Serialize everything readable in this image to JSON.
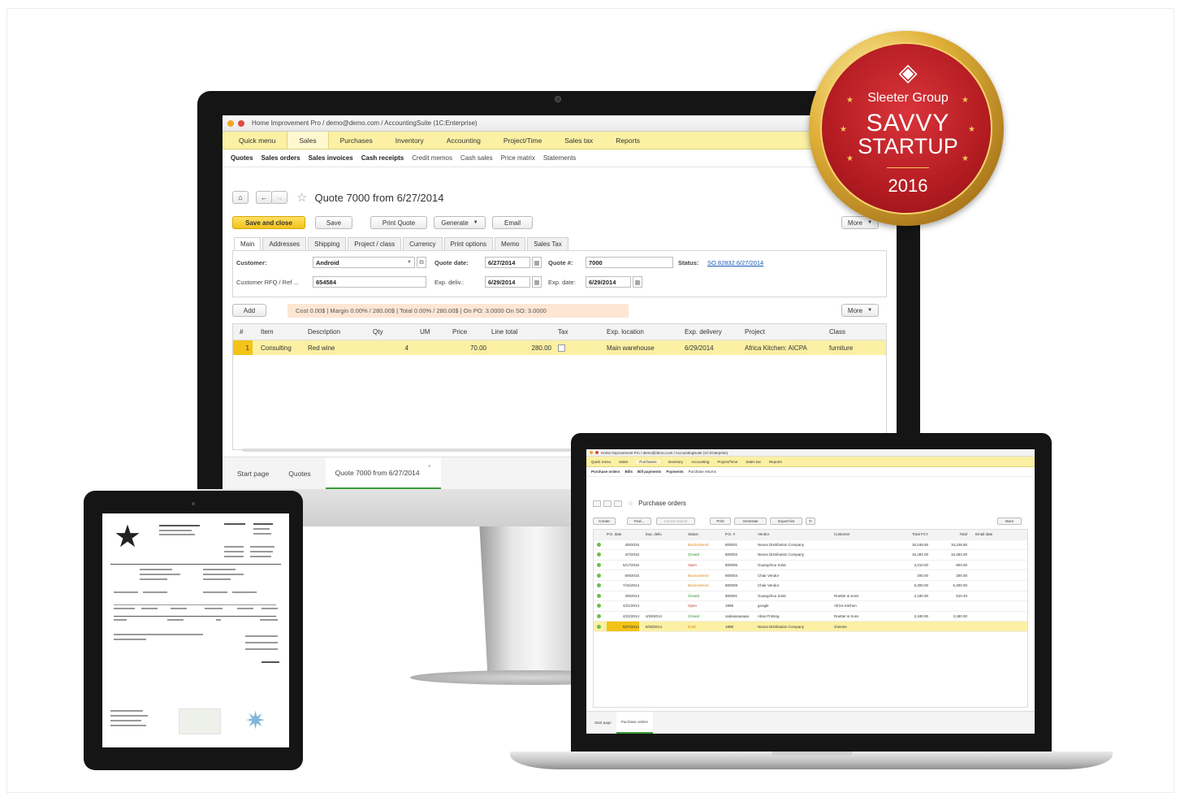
{
  "imac": {
    "window_title": "Home Improvement Pro / demo@demo.com / AccountingSuite (1C:Enterprise)",
    "menu": [
      "Quick menu",
      "Sales",
      "Purchases",
      "Inventory",
      "Accounting",
      "Project/Time",
      "Sales tax",
      "Reports"
    ],
    "active_menu": "Sales",
    "submenu": [
      {
        "label": "Quotes",
        "bold": true
      },
      {
        "label": "Sales orders",
        "bold": true
      },
      {
        "label": "Sales invoices",
        "bold": true
      },
      {
        "label": "Cash receipts",
        "bold": true
      },
      {
        "label": "Credit memos",
        "bold": false
      },
      {
        "label": "Cash sales",
        "bold": false
      },
      {
        "label": "Price matrix",
        "bold": false
      },
      {
        "label": "Statements",
        "bold": false
      }
    ],
    "doc_title": "Quote 7000 from 6/27/2014",
    "actions": {
      "save_close": "Save and close",
      "save": "Save",
      "print_quote": "Print Quote",
      "generate": "Generate",
      "email": "Email",
      "more": "More"
    },
    "tabs": [
      "Main",
      "Addresses",
      "Shipping",
      "Project / class",
      "Currency",
      "Print options",
      "Memo",
      "Sales Tax"
    ],
    "form": {
      "customer_label": "Customer:",
      "customer_value": "Android",
      "quote_date_label": "Quote date:",
      "quote_date_value": "6/27/2014",
      "quote_no_label": "Quote #:",
      "quote_no_value": "7000",
      "status_label": "Status:",
      "status_value": "SO 82832 6/27/2014",
      "rfq_label": "Customer RFQ / Ref ...",
      "rfq_value": "654584",
      "exp_deliv_label": "Exp. deliv.:",
      "exp_deliv_value": "6/29/2014",
      "exp_date_label": "Exp. date:",
      "exp_date_value": "6/29/2014"
    },
    "add_label": "Add",
    "summary": "Cost 0.00$ | Margin 0.00% / 280.00$ | Total 0.00% / 280.00$ | On PO: 3.0000 On SO: 3.0000",
    "grid": {
      "headers": [
        "#",
        "Item",
        "Description",
        "Qty",
        "UM",
        "Price",
        "Line total",
        "Tax",
        "Exp. location",
        "Exp. delivery",
        "Project",
        "Class"
      ],
      "rows": [
        [
          "1",
          "Consulting",
          "Red wine",
          "4",
          "",
          "70.00",
          "280.00",
          "",
          "Main warehouse",
          "6/29/2014",
          "Africa Kitchen: AICPA",
          "furniture"
        ]
      ]
    },
    "bottom_tabs": [
      "Start page",
      "Quotes",
      "Quote 7000 from 6/27/2014"
    ]
  },
  "badge": {
    "group": "Sleeter Group",
    "line1": "SAVVY",
    "line2": "STARTUP",
    "year": "2016",
    "colors": {
      "red": "#b41c22",
      "gold": "#e1b23a"
    }
  },
  "laptop": {
    "window_title": "Home Improvement Pro / demo@demo.com / AccountingSuite (1C:Enterprise)",
    "menu": [
      "Quick menu",
      "Sales",
      "Purchases",
      "Inventory",
      "Accounting",
      "Project/Time",
      "Sales tax",
      "Reports"
    ],
    "submenu": [
      "Purchase orders",
      "Bills",
      "Bill payments",
      "Payments",
      "Purchase returns"
    ],
    "doc_title": "Purchase orders",
    "buttons": [
      "Create",
      "Find...",
      "Cancel search",
      "Print",
      "Generate",
      "Export list",
      "More"
    ],
    "headers": [
      "P.O. date",
      "Exp. deliv.",
      "Status",
      "P.O. #",
      "Vendor",
      "Customer",
      "Total FCY",
      "Total",
      "Email date"
    ],
    "rows": [
      [
        "4/9/2015",
        "",
        "Backordered",
        "800001",
        "Nexus Distribution Company",
        "",
        "16,248.56",
        "16,248.56",
        ""
      ],
      [
        "4/7/2015",
        "",
        "Closed",
        "800002",
        "Nexus Distribution Company",
        "",
        "16,484.00",
        "16,484.00",
        ""
      ],
      [
        "6/17/2015",
        "",
        "Open",
        "800005",
        "Guangzhou Solar",
        "",
        "3,210.00",
        "803.00",
        ""
      ],
      [
        "6/9/2015",
        "",
        "Backordered",
        "800004",
        "Chair Vendor",
        "",
        "200.00",
        "200.00",
        ""
      ],
      [
        "7/15/2014",
        "",
        "Backordered",
        "800009",
        "Chair Vendor",
        "",
        "6,300.00",
        "6,300.00",
        ""
      ],
      [
        "4/9/2014",
        "",
        "Closed",
        "800001",
        "Guangzhou Solar",
        "Roetter & Sons",
        "3,180.00",
        "510.40",
        ""
      ],
      [
        "4/21/2014",
        "",
        "Open",
        "1998",
        "google",
        "Africa Kitchen",
        "",
        "",
        ""
      ],
      [
        "4/22/2014",
        "4/29/2014",
        "Closed",
        "sadasasasaaa",
        "Atlas Printing",
        "Roetter & Sons",
        "3,180.00",
        "3,180.00",
        ""
      ],
      [
        "6/27/2014",
        "6/29/2014",
        "Draft",
        "1998",
        "Nexus Distribution Company",
        "cheenie",
        "",
        "",
        ""
      ]
    ],
    "bottom_tabs": [
      "Start page",
      "Purchase orders"
    ]
  }
}
